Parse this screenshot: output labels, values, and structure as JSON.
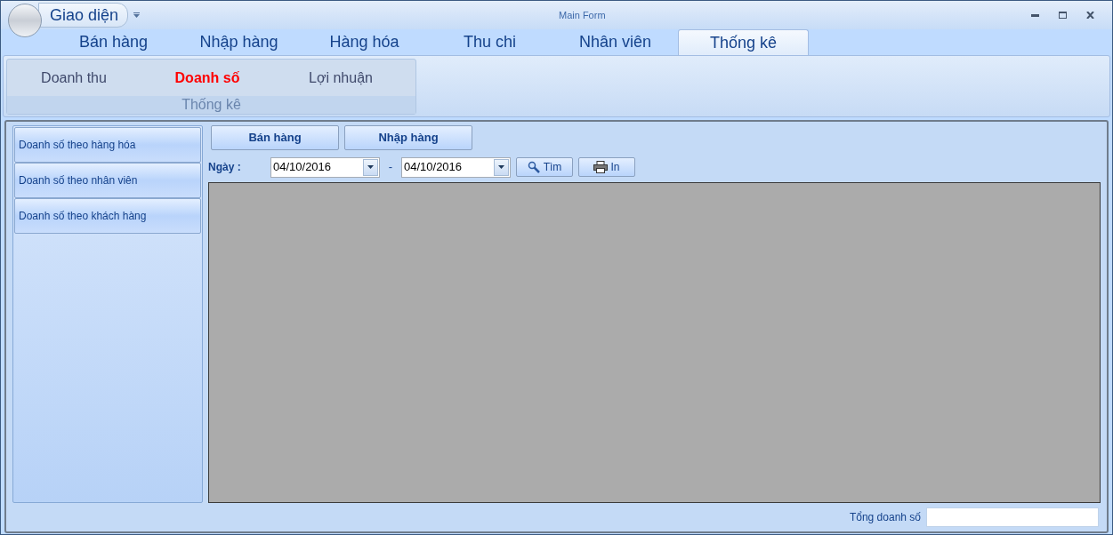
{
  "window": {
    "title": "Main Form",
    "app_button": "Giao diện"
  },
  "tabs": [
    {
      "label": "Bán hàng",
      "selected": false
    },
    {
      "label": "Nhập hàng",
      "selected": false
    },
    {
      "label": "Hàng hóa",
      "selected": false
    },
    {
      "label": "Thu chi",
      "selected": false
    },
    {
      "label": "Nhân viên",
      "selected": false
    },
    {
      "label": "Thống kê",
      "selected": true
    }
  ],
  "ribbon": {
    "group_label": "Thống kê",
    "items": [
      {
        "label": "Doanh thu",
        "selected": false
      },
      {
        "label": "Doanh số",
        "selected": true
      },
      {
        "label": "Lợi nhuận",
        "selected": false
      }
    ]
  },
  "sidebar": {
    "items": [
      "Doanh số theo hàng hóa",
      "Doanh số theo nhân viên",
      "Doanh số theo khách hàng"
    ]
  },
  "toolbar": {
    "buttons": [
      "Bán hàng",
      "Nhập hàng"
    ]
  },
  "filter": {
    "label": "Ngày :",
    "from": "04/10/2016",
    "separator": "-",
    "to": "04/10/2016",
    "search_button": "Tìm",
    "print_button": "In"
  },
  "footer": {
    "label": "Tổng doanh số"
  }
}
